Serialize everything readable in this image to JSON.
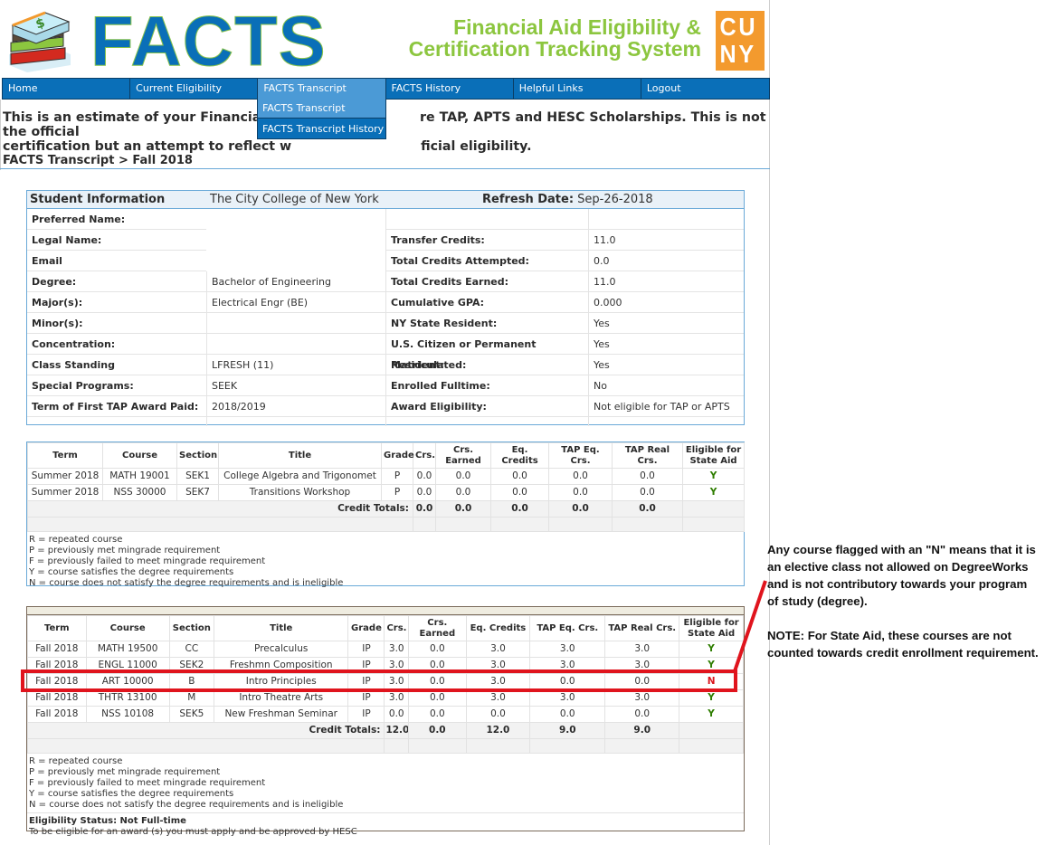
{
  "header": {
    "logo_text": "FACTS",
    "tagline_line1": "Financial Aid Eligibility &",
    "tagline_line2": "Certification Tracking System",
    "cuny_logo_line1": "CU",
    "cuny_logo_line2": "NY",
    "colors": {
      "facts_blue": "#0a6fb8",
      "tagline_green": "#8cc63f",
      "cuny_orange": "#f39a2e"
    }
  },
  "nav": {
    "items": [
      {
        "label": "Home",
        "active": false
      },
      {
        "label": "Current Eligibility",
        "active": false
      },
      {
        "label": "FACTS Transcript",
        "active": true
      },
      {
        "label": "FACTS History",
        "active": false
      },
      {
        "label": "Helpful Links",
        "active": false
      },
      {
        "label": "Logout",
        "active": false
      }
    ],
    "dropdown": [
      {
        "label": "FACTS Transcript"
      },
      {
        "label": "FACTS Transcript History"
      }
    ]
  },
  "intro": {
    "text": "This is an estimate of your Financial Aid eligibility for NYS programs, where TAP, APTS and HESC Scholarships. This is not the official certification but an attempt to reflect what will determine your official eligibility.",
    "visible_left": "This is an estimate of your Financial Ai",
    "visible_right": "re TAP, APTS and HESC Scholarships. This is not the official",
    "visible_left2": "certification but an attempt to reflect w",
    "visible_right2": "ficial eligibility."
  },
  "breadcrumb": "FACTS Transcript > Fall 2018",
  "student_info": {
    "title": "Student Information",
    "college": "The City College of New York",
    "refresh_label": "Refresh Date:",
    "refresh_date": "Sep-26-2018",
    "left": [
      {
        "label": "Preferred Name:",
        "value": ""
      },
      {
        "label": "Legal Name:",
        "value": ""
      },
      {
        "label": "Email",
        "value": ""
      },
      {
        "label": "Degree:",
        "value": "Bachelor of Engineering"
      },
      {
        "label": "Major(s):",
        "value": "Electrical Engr (BE)"
      },
      {
        "label": "Minor(s):",
        "value": ""
      },
      {
        "label": "Concentration:",
        "value": ""
      },
      {
        "label": "Class Standing",
        "value": "LFRESH (11)"
      },
      {
        "label": "Special Programs:",
        "value": "SEEK"
      },
      {
        "label": "Term of First TAP Award Paid:",
        "value": "2018/2019"
      }
    ],
    "right": [
      {
        "label": "",
        "value": ""
      },
      {
        "label": "Transfer Credits:",
        "value": "11.0"
      },
      {
        "label": "Total Credits Attempted:",
        "value": "0.0"
      },
      {
        "label": "Total Credits Earned:",
        "value": "11.0"
      },
      {
        "label": "Cumulative GPA:",
        "value": "0.000"
      },
      {
        "label": "NY State Resident:",
        "value": "Yes"
      },
      {
        "label": "U.S. Citizen or Permanent Resident:",
        "value": "Yes"
      },
      {
        "label": "Matriculated:",
        "value": "Yes"
      },
      {
        "label": "Enrolled Fulltime:",
        "value": "No"
      },
      {
        "label": "Award Eligibility:",
        "value": "Not eligible for TAP or APTS"
      }
    ]
  },
  "table_headers": [
    "Term",
    "Course",
    "Section",
    "Title",
    "Grade",
    "Crs.",
    "Crs. Earned",
    "Eq. Credits",
    "TAP Eq. Crs.",
    "TAP Real Crs.",
    "Eligible for State Aid"
  ],
  "summer": {
    "rows": [
      [
        "Summer 2018",
        "MATH 19001",
        "SEK1",
        "College Algebra and Trigonomet",
        "P",
        "0.0",
        "0.0",
        "0.0",
        "0.0",
        "0.0",
        "Y"
      ],
      [
        "Summer 2018",
        "NSS 30000",
        "SEK7",
        "Transitions Workshop",
        "P",
        "0.0",
        "0.0",
        "0.0",
        "0.0",
        "0.0",
        "Y"
      ]
    ],
    "totals_label": "Credit Totals:",
    "totals": [
      "0.0",
      "0.0",
      "0.0",
      "0.0",
      "0.0"
    ]
  },
  "fall": {
    "rows": [
      [
        "Fall 2018",
        "MATH 19500",
        "CC",
        "Precalculus",
        "IP",
        "3.0",
        "0.0",
        "3.0",
        "3.0",
        "3.0",
        "Y"
      ],
      [
        "Fall 2018",
        "ENGL 11000",
        "SEK2",
        "Freshmn Composition",
        "IP",
        "3.0",
        "0.0",
        "3.0",
        "3.0",
        "3.0",
        "Y"
      ],
      [
        "Fall 2018",
        "ART 10000",
        "B",
        "Intro Principles",
        "IP",
        "3.0",
        "0.0",
        "3.0",
        "0.0",
        "0.0",
        "N"
      ],
      [
        "Fall 2018",
        "THTR 13100",
        "M",
        "Intro Theatre Arts",
        "IP",
        "3.0",
        "0.0",
        "3.0",
        "3.0",
        "3.0",
        "Y"
      ],
      [
        "Fall 2018",
        "NSS 10108",
        "SEK5",
        "New Freshman Seminar",
        "IP",
        "0.0",
        "0.0",
        "0.0",
        "0.0",
        "0.0",
        "Y"
      ]
    ],
    "totals_label": "Credit Totals:",
    "totals": [
      "12.0",
      "0.0",
      "12.0",
      "9.0",
      "9.0"
    ],
    "eligibility_status": "Eligibility Status: Not Full-time",
    "eligibility_note": "To be eligible for an award (s) you must apply and be approved by HESC"
  },
  "legend": [
    "R = repeated course",
    "P = previously met mingrade requirement",
    "F = previously failed to meet mingrade requirement",
    "Y = course satisfies the degree requirements",
    "N = course does not satisfy the degree requirements and is ineligible"
  ],
  "annotation": {
    "paragraph1": "Any course flagged with an \"N\" means that it is an elective class not allowed on DegreeWorks and is not contributory towards your program of study (degree).",
    "paragraph2": "NOTE: For State Aid, these courses are not counted towards credit enrollment requirement.",
    "highlight_color": "#e0141d"
  },
  "flag_colors": {
    "Y": "#2e7d00",
    "N": "#d9141c"
  }
}
